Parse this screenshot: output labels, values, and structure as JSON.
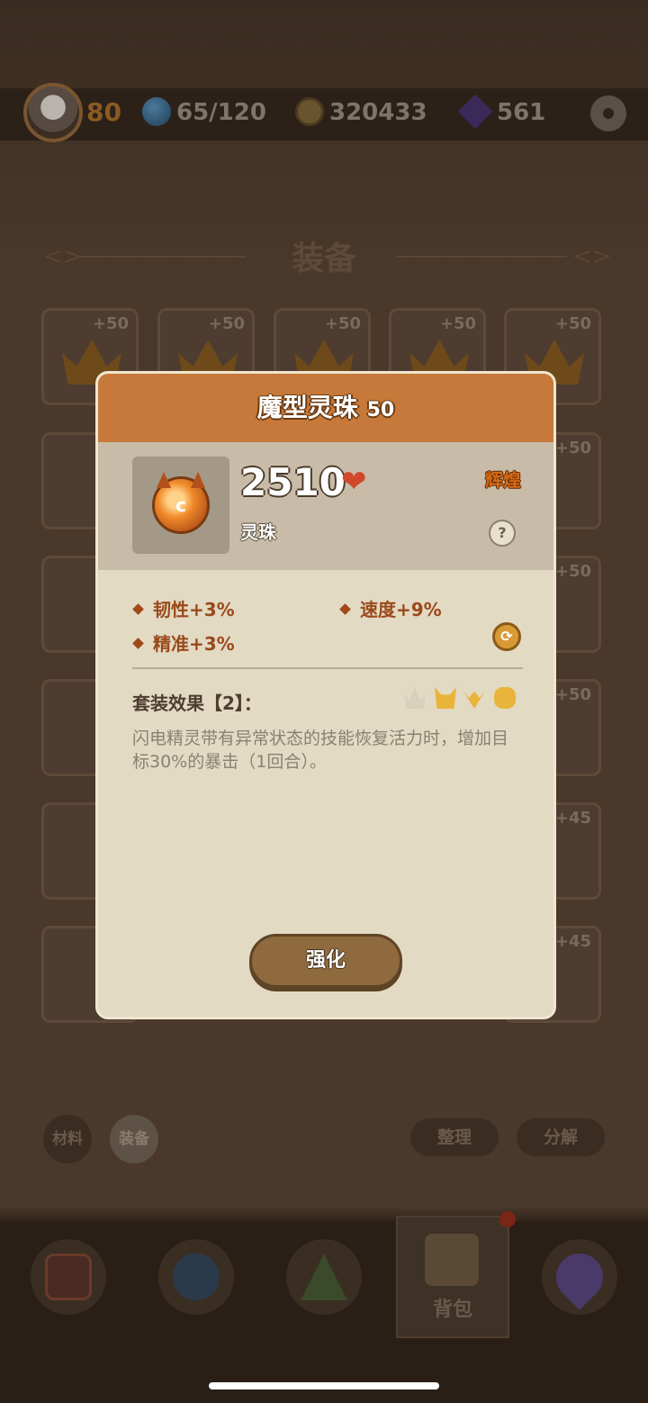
{
  "topbar": {
    "level": "80",
    "stamina": "65/120",
    "coins": "320433",
    "gems": "561"
  },
  "section": {
    "title": "装备"
  },
  "grid": {
    "plus_labels": [
      "+50",
      "+50",
      "+50",
      "+50",
      "+50",
      "+50",
      "+50",
      "+50",
      "+45",
      "+45"
    ]
  },
  "filters": {
    "materials": "材料",
    "equipment": "装备",
    "sort": "整理",
    "decompose": "分解"
  },
  "nav": {
    "bag": "背包"
  },
  "modal": {
    "title": "魔型灵珠",
    "title_level": "50",
    "power": "2510",
    "rarity": "辉煌",
    "type": "灵珠",
    "help": "?",
    "stats": [
      "韧性+3%",
      "速度+9%",
      "精准+3%"
    ],
    "set_title": "套装效果【2】：",
    "set_desc": "闪电精灵带有异常状态的技能恢复活力时，增加目标30%的暴击（1回合）。",
    "enhance": "强化"
  },
  "colors": {
    "header": "#c6793a",
    "rarity": "#d86a14",
    "stat": "#9a4a1c"
  }
}
